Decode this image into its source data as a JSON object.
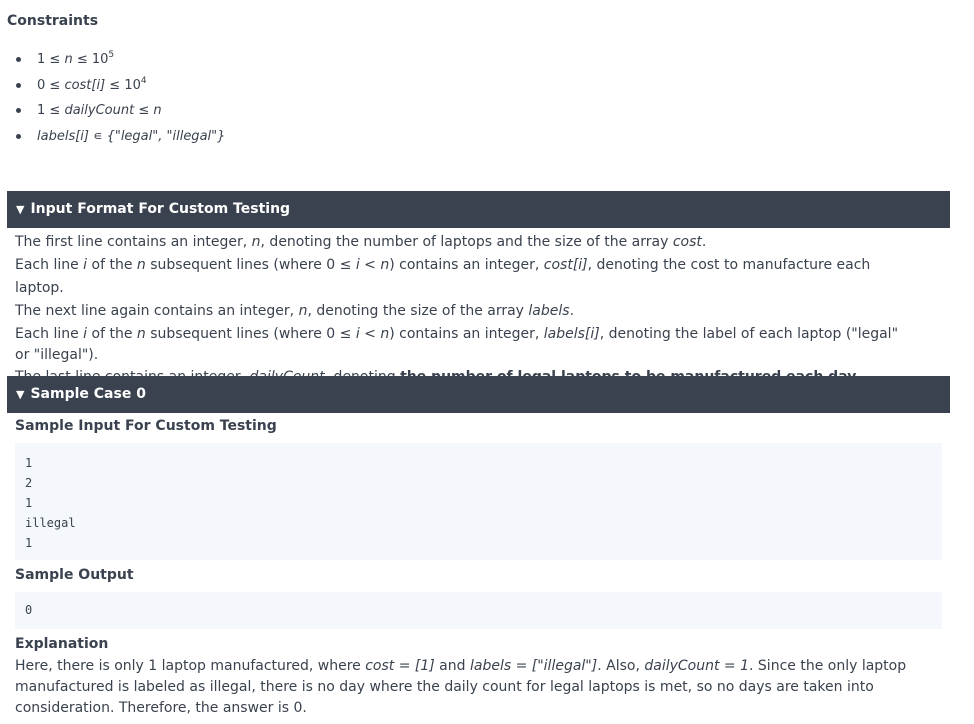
{
  "constraints": {
    "title": "Constraints",
    "items": [
      {
        "pre": "1 ≤ ",
        "var": "n",
        "mid": " ≤ 10",
        "sup": "5"
      },
      {
        "pre": "0 ≤ ",
        "var": "cost[i]",
        "mid": " ≤ 10",
        "sup": "4"
      },
      {
        "pre": "1 ≤ ",
        "var": "dailyCount",
        "mid": " ≤ ",
        "var2": "n"
      },
      {
        "var": "labels[i]",
        "mid": " ∊ {\"legal\", \"illegal\"}"
      }
    ]
  },
  "input_format": {
    "title": "Input Format For Custom Testing",
    "line1": {
      "a": "The first line contains an integer, ",
      "v1": "n",
      "b": ", denoting the number of laptops and the size of the array ",
      "v2": "cost",
      "c": "."
    },
    "line2": {
      "a": "Each line ",
      "v1": "i",
      "b": " of the ",
      "v2": "n",
      "c": " subsequent lines (where 0 ≤ ",
      "v3": "i",
      "d": " < ",
      "v4": "n",
      "e": ") contains an integer, ",
      "v5": "cost[i]",
      "f": ", denoting the cost to manufacture each laptop."
    },
    "line3": {
      "a": "The next line again contains an integer, ",
      "v1": "n",
      "b": ", denoting the size of the array ",
      "v2": "labels",
      "c": "."
    },
    "line4": {
      "a": "Each line ",
      "v1": "i",
      "b": " of the ",
      "v2": "n",
      "c": " subsequent lines (where 0 ≤ ",
      "v3": "i",
      "d": " < ",
      "v4": "n",
      "e": ") contains an integer, ",
      "v5": "labels[i]",
      "f": ", denoting the label of each laptop (\"legal\" or \"illegal\")."
    },
    "line5": {
      "a": "The last line contains an integer, ",
      "v1": "dailyCount",
      "b": ", denoting ",
      "strong": "the number of legal laptops to be manufactured each day."
    }
  },
  "sample_case": {
    "title": "Sample Case 0",
    "input_title": "Sample Input For Custom Testing",
    "input_lines": [
      "1",
      "2",
      "1",
      "illegal",
      "1"
    ],
    "output_title": "Sample Output",
    "output_lines": [
      "0"
    ],
    "explanation_title": "Explanation",
    "explanation": {
      "a": "Here, there is only 1 laptop manufactured, where ",
      "v1": "cost = [1]",
      "b": " and ",
      "v2": "labels = [\"illegal\"]",
      "c": ". Also, ",
      "v3": "dailyCount = 1",
      "d": ". Since the only laptop manufactured is labeled as illegal, there is no day where the daily count for legal laptops is met, so no days are taken into consideration. Therefore, the answer is 0."
    }
  }
}
